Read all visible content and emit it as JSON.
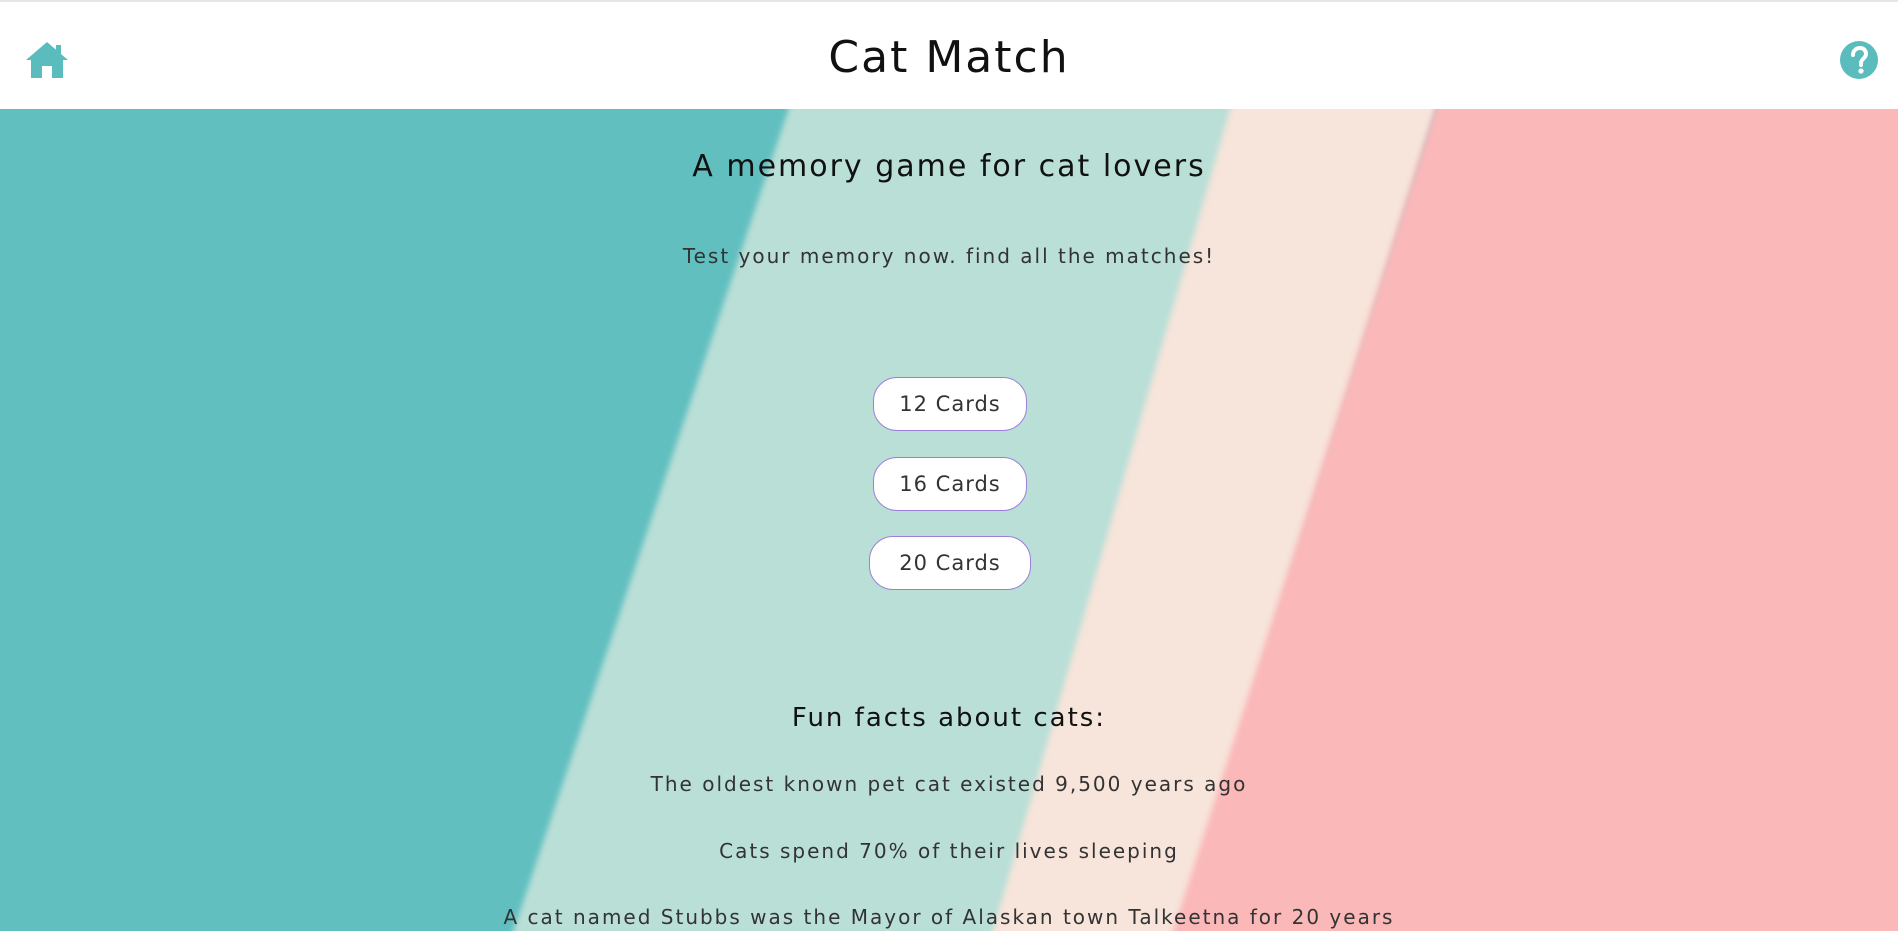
{
  "header": {
    "title": "Cat Match",
    "home_icon": "home-icon",
    "help_icon": "question-circle-icon",
    "accent_color": "#5bbcbd"
  },
  "hero": {
    "subtitle": "A memory game for cat lovers",
    "tagline": "Test your memory now. find all the matches!"
  },
  "game_options": [
    {
      "label": "12 Cards"
    },
    {
      "label": "16 Cards"
    },
    {
      "label": "20 Cards"
    }
  ],
  "facts": {
    "heading": "Fun facts about cats:",
    "items": [
      "The oldest known pet cat existed 9,500 years ago",
      "Cats spend 70% of their lives sleeping",
      "A cat named Stubbs was the Mayor of Alaskan town Talkeetna for 20 years"
    ]
  },
  "background_colors": {
    "teal": "#61bfc0",
    "mint": "#b9dfd7",
    "cream": "#f7e4da",
    "pink": "#fbb8b9"
  }
}
